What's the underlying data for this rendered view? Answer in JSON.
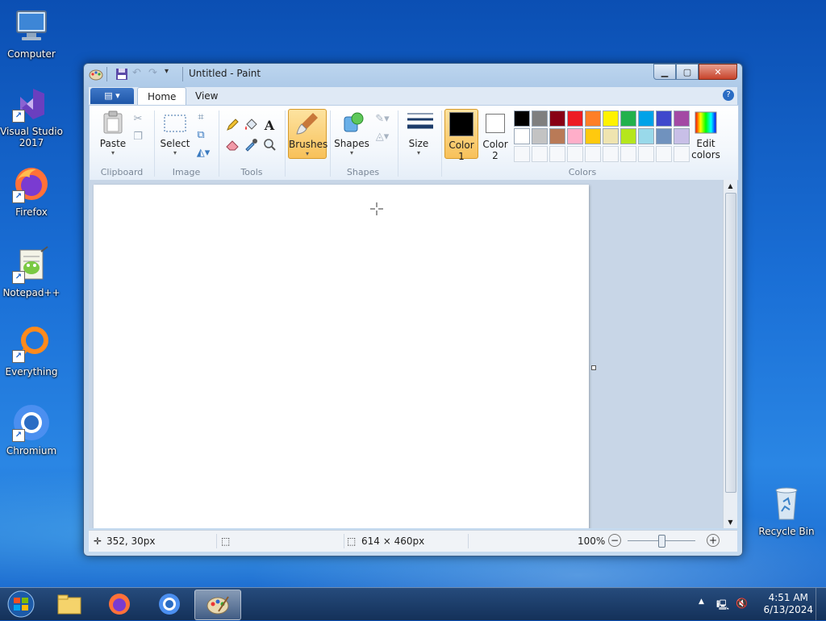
{
  "desktop": {
    "icons": [
      {
        "label": "Computer"
      },
      {
        "label": "Visual Studio 2017"
      },
      {
        "label": "Firefox"
      },
      {
        "label": "Notepad++"
      },
      {
        "label": "Everything"
      },
      {
        "label": "Chromium"
      },
      {
        "label": "Recycle Bin"
      }
    ]
  },
  "window": {
    "title": "Untitled - Paint",
    "tabs": {
      "home": "Home",
      "view": "View"
    },
    "help": "?"
  },
  "ribbon": {
    "clipboard": {
      "label": "Clipboard",
      "paste": "Paste"
    },
    "image": {
      "label": "Image",
      "select": "Select"
    },
    "tools": {
      "label": "Tools"
    },
    "brushes": {
      "label": "Brushes"
    },
    "shapes": {
      "label": "Shapes",
      "shapes": "Shapes"
    },
    "size": {
      "label": "Size"
    },
    "colors": {
      "label": "Colors",
      "color1": [
        "Color",
        "1"
      ],
      "color2": [
        "Color",
        "2"
      ],
      "edit": [
        "Edit",
        "colors"
      ],
      "color1_value": "#000000",
      "color2_value": "#ffffff",
      "palette_row1": [
        "#000000",
        "#7f7f7f",
        "#880015",
        "#ed1c24",
        "#ff7f27",
        "#fff200",
        "#22b14c",
        "#00a2e8",
        "#3f48cc",
        "#a349a4"
      ],
      "palette_row2": [
        "#ffffff",
        "#c3c3c3",
        "#b97a57",
        "#ffaec9",
        "#ffc90e",
        "#efe4b0",
        "#b5e61d",
        "#99d9ea",
        "#7092be",
        "#c8bfe7"
      ]
    }
  },
  "status": {
    "cursor": "352, 30px",
    "selection": "",
    "size": "614 × 460px",
    "zoom": "100%"
  },
  "taskbar": {
    "time": "4:51 AM",
    "date": "6/13/2024"
  }
}
